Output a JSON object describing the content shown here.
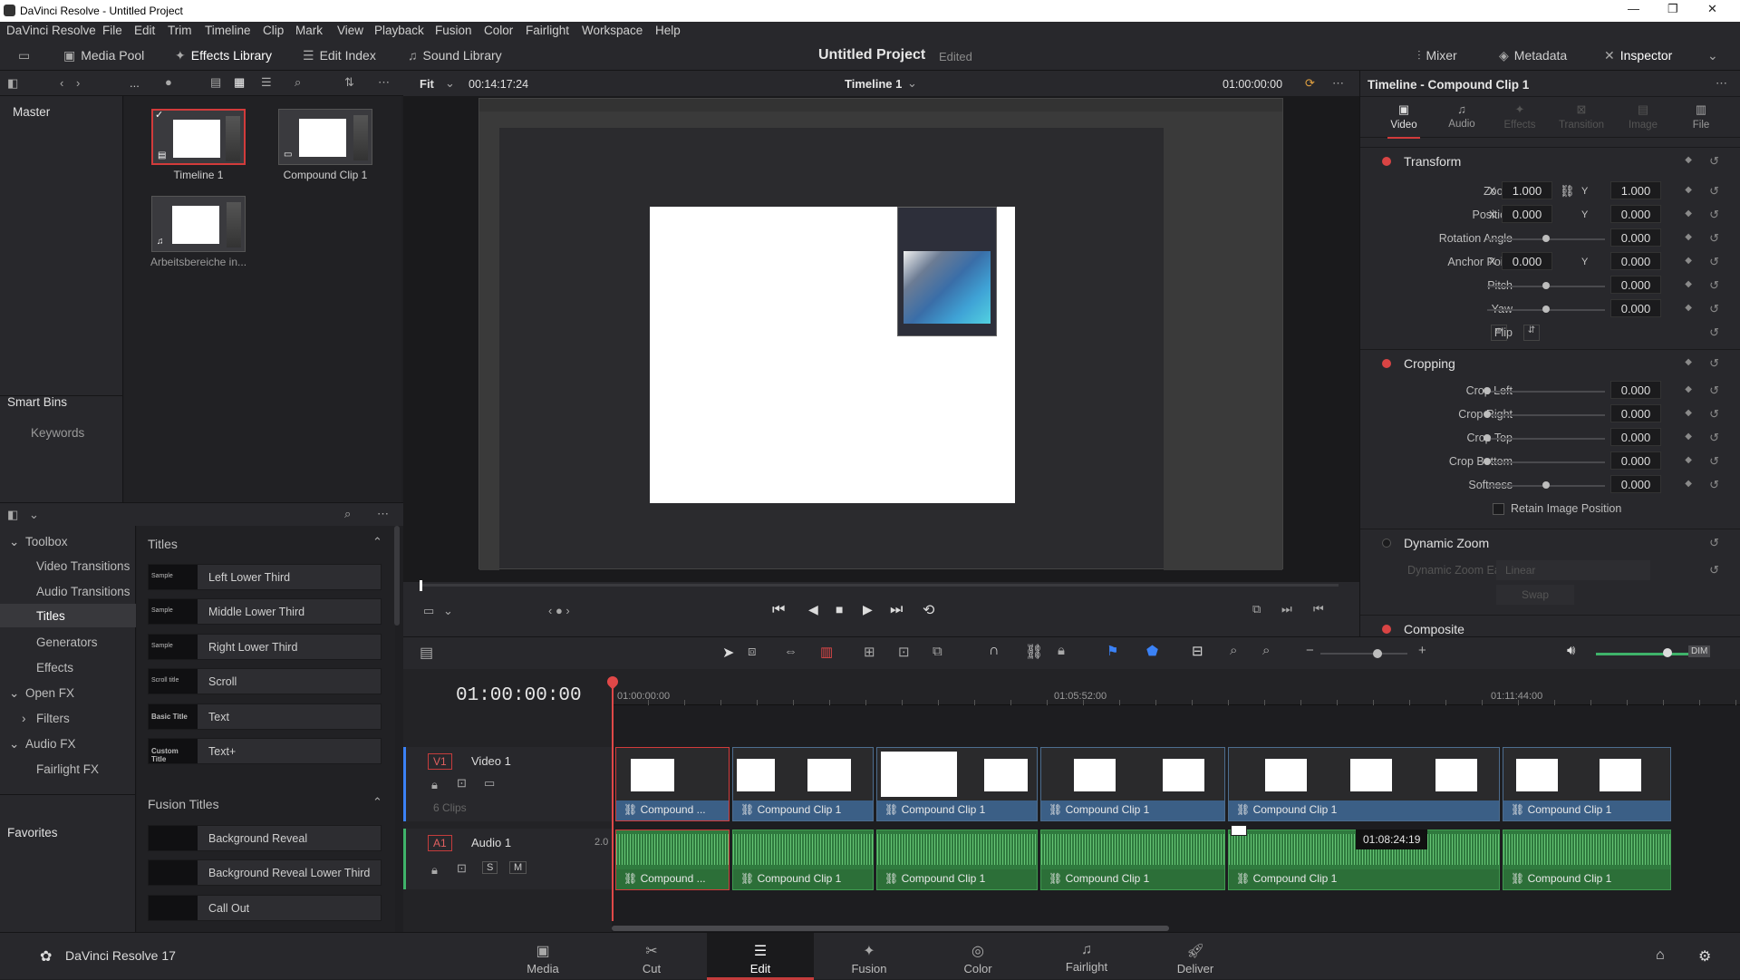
{
  "window": {
    "title": "DaVinci Resolve - Untitled Project"
  },
  "menu": [
    "DaVinci Resolve",
    "File",
    "Edit",
    "Trim",
    "Timeline",
    "Clip",
    "Mark",
    "View",
    "Playback",
    "Fusion",
    "Color",
    "Fairlight",
    "Workspace",
    "Help"
  ],
  "toolbar": {
    "media_pool": "Media Pool",
    "effects_library": "Effects Library",
    "edit_index": "Edit Index",
    "sound_library": "Sound Library",
    "project_title": "Untitled Project",
    "project_status": "Edited",
    "mixer": "Mixer",
    "metadata": "Metadata",
    "inspector": "Inspector"
  },
  "pool_header": {
    "more": "...",
    "fit": "Fit",
    "src_timecode": "00:14:17:24"
  },
  "viewer_header": {
    "timeline": "Timeline 1",
    "rec_timecode": "01:00:00:00"
  },
  "bins": {
    "master": "Master",
    "smart_bins": "Smart Bins",
    "keywords": "Keywords",
    "favorites": "Favorites"
  },
  "media": [
    {
      "label": "Timeline 1"
    },
    {
      "label": "Compound Clip 1"
    },
    {
      "label": "Arbeitsbereiche in..."
    }
  ],
  "fx_tree": {
    "toolbox": "Toolbox",
    "video_transitions": "Video Transitions",
    "audio_transitions": "Audio Transitions",
    "titles": "Titles",
    "generators": "Generators",
    "effects": "Effects",
    "open_fx": "Open FX",
    "filters": "Filters",
    "audio_fx": "Audio FX",
    "fairlight_fx": "Fairlight FX"
  },
  "fx_list": {
    "titles_header": "Titles",
    "titles": [
      {
        "label": "Left Lower Third",
        "thumb": "Sample"
      },
      {
        "label": "Middle Lower Third",
        "thumb": "Sample"
      },
      {
        "label": "Right Lower Third",
        "thumb": "Sample"
      },
      {
        "label": "Scroll",
        "thumb": "Scroll title"
      },
      {
        "label": "Text",
        "thumb": "Basic Title"
      },
      {
        "label": "Text+",
        "thumb": "Custom Title"
      }
    ],
    "fusion_header": "Fusion Titles",
    "fusion": [
      {
        "label": "Background Reveal",
        "thumb": ""
      },
      {
        "label": "Background Reveal Lower Third",
        "thumb": ""
      },
      {
        "label": "Call Out",
        "thumb": ""
      }
    ]
  },
  "timeline": {
    "timecode": "01:00:00:00",
    "ruler": [
      "01:00:00:00",
      "01:05:52:00",
      "01:11:44:00"
    ],
    "video_track": {
      "id": "V1",
      "name": "Video 1",
      "clips_count": "6 Clips"
    },
    "audio_track": {
      "id": "A1",
      "name": "Audio 1",
      "level": "2.0",
      "solo": "S",
      "mute": "M"
    },
    "clip_labels": [
      "Compound ...",
      "Compound Clip 1",
      "Compound Clip 1",
      "Compound Clip 1",
      "Compound Clip 1",
      "Compound Clip 1"
    ],
    "hover_timecode": "01:08:24:19"
  },
  "inspector": {
    "title": "Timeline - Compound Clip 1",
    "tabs": [
      "Video",
      "Audio",
      "Effects",
      "Transition",
      "Image",
      "File"
    ],
    "transform": {
      "header": "Transform",
      "zoom_label": "Zoom",
      "zoom_x": "1.000",
      "zoom_y": "1.000",
      "position_label": "Position",
      "pos_x": "0.000",
      "pos_y": "0.000",
      "rotation_label": "Rotation Angle",
      "rotation": "0.000",
      "anchor_label": "Anchor Point",
      "anchor_x": "0.000",
      "anchor_y": "0.000",
      "pitch_label": "Pitch",
      "pitch": "0.000",
      "yaw_label": "Yaw",
      "yaw": "0.000",
      "flip_label": "Flip",
      "x": "X",
      "y": "Y"
    },
    "cropping": {
      "header": "Cropping",
      "crop_left_label": "Crop Left",
      "crop_left": "0.000",
      "crop_right_label": "Crop Right",
      "crop_right": "0.000",
      "crop_top_label": "Crop Top",
      "crop_top": "0.000",
      "crop_bottom_label": "Crop Bottom",
      "crop_bottom": "0.000",
      "softness_label": "Softness",
      "softness": "0.000",
      "retain_label": "Retain Image Position"
    },
    "dynamic_zoom": {
      "header": "Dynamic Zoom",
      "ease_label": "Dynamic Zoom Ease",
      "ease_value": "Linear",
      "swap": "Swap"
    },
    "composite": {
      "header": "Composite"
    }
  },
  "bottom": {
    "app": "DaVinci Resolve 17",
    "pages": [
      "Media",
      "Cut",
      "Edit",
      "Fusion",
      "Color",
      "Fairlight",
      "Deliver"
    ],
    "active_page": "Edit"
  },
  "colors": {
    "accent_red": "#d23b3b",
    "video_clip": "#3b5f86",
    "audio_clip": "#2f7a3e",
    "bg": "#28282c"
  }
}
